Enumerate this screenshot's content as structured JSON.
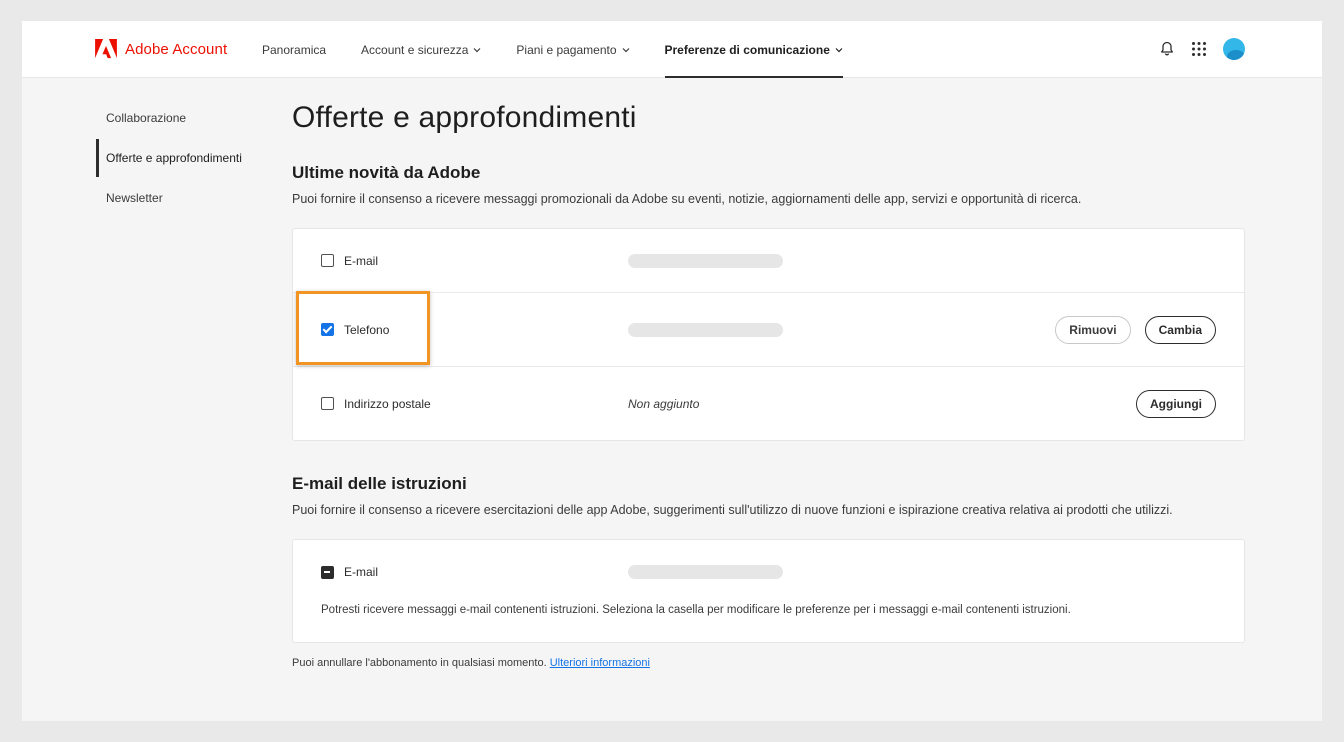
{
  "header": {
    "brand": "Adobe Account",
    "nav": [
      {
        "label": "Panoramica"
      },
      {
        "label": "Account e sicurezza"
      },
      {
        "label": "Piani e pagamento"
      },
      {
        "label": "Preferenze di comunicazione"
      }
    ],
    "icons": [
      "bell-icon",
      "app-grid-icon",
      "avatar"
    ],
    "brand_color": "#eb1000"
  },
  "sidebar": {
    "items": [
      {
        "label": "Collaborazione"
      },
      {
        "label": "Offerte e approfondimenti"
      },
      {
        "label": "Newsletter"
      }
    ]
  },
  "main": {
    "title": "Offerte e approfondimenti",
    "section1": {
      "title": "Ultime novità da Adobe",
      "description": "Puoi fornire il consenso a ricevere messaggi promozionali da Adobe su eventi, notizie, aggiornamenti delle app, servizi e opportunità di ricerca.",
      "rows": [
        {
          "label": "E-mail",
          "checked": false
        },
        {
          "label": "Telefono",
          "checked": true,
          "remove_label": "Rimuovi",
          "change_label": "Cambia"
        },
        {
          "label": "Indirizzo postale",
          "checked": false,
          "value": "Non aggiunto",
          "add_label": "Aggiungi"
        }
      ]
    },
    "section2": {
      "title": "E-mail delle istruzioni",
      "description": "Puoi fornire il consenso a ricevere esercitazioni delle app Adobe, suggerimenti sull'utilizzo di nuove funzioni e ispirazione creativa relativa ai prodotti che utilizzi.",
      "row": {
        "label": "E-mail",
        "state": "indeterminate"
      },
      "note": "Potresti ricevere messaggi e-mail contenenti istruzioni. Seleziona la casella per modificare le preferenze per i messaggi e-mail contenenti istruzioni."
    },
    "footer": {
      "text": "Puoi annullare l'abbonamento in qualsiasi momento.",
      "link": "Ulteriori informazioni"
    }
  },
  "colors": {
    "highlight": "#f29423",
    "checkbox_checked": "#1473e6",
    "link": "#1473e6"
  }
}
